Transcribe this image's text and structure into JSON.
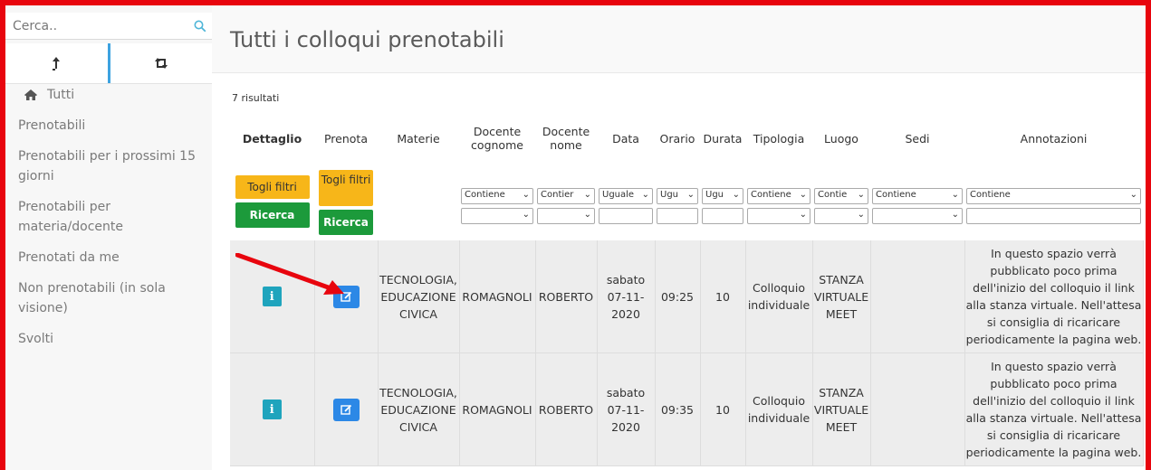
{
  "sidebar": {
    "search_placeholder": "Cerca..",
    "nav": [
      {
        "label": "Tutti",
        "icon": "home-icon"
      },
      {
        "label": "Prenotabili"
      },
      {
        "label": "Prenotabili per i prossimi 15 giorni"
      },
      {
        "label": "Prenotabili per materia/docente"
      },
      {
        "label": "Prenotati da me"
      },
      {
        "label": "Non prenotabili (in sola visione)"
      },
      {
        "label": "Svolti"
      }
    ],
    "icons": [
      "upload-arrow-icon",
      "retweet-icon"
    ]
  },
  "page": {
    "title": "Tutti i colloqui prenotabili",
    "results": "7 risultati"
  },
  "table": {
    "headers": [
      "Dettaglio",
      "Prenota",
      "Materie",
      "Docente cognome",
      "Docente nome",
      "Data",
      "Orario",
      "Durata",
      "Tipologia",
      "Luogo",
      "Sedi",
      "Annotazioni"
    ],
    "filters": {
      "togli_filtri": "Togli filtri",
      "ricerca": "Ricerca",
      "selects": {
        "docente_cognome": "Contiene",
        "docente_nome": "Contier",
        "data": "Uguale",
        "orario": "Ugu",
        "durata": "Ugu",
        "tipologia": "Contiene",
        "luogo": "Contie",
        "sedi": "Contiene",
        "annotazioni": "Contiene"
      }
    },
    "rows": [
      {
        "materie": "TECNOLOGIA, EDUCAZIONE CIVICA",
        "cognome": "ROMAGNOLI",
        "nome": "ROBERTO",
        "data": "sabato 07-11-2020",
        "orario": "09:25",
        "durata": "10",
        "tipologia": "Colloquio individuale",
        "luogo": "STANZA VIRTUALE MEET",
        "sedi": "",
        "annotazioni": "In questo spazio verrà pubblicato poco prima dell'inizio del colloquio il link alla stanza virtuale. Nell'attesa si consiglia di ricaricare periodicamente la pagina web."
      },
      {
        "materie": "TECNOLOGIA, EDUCAZIONE CIVICA",
        "cognome": "ROMAGNOLI",
        "nome": "ROBERTO",
        "data": "sabato 07-11-2020",
        "orario": "09:35",
        "durata": "10",
        "tipologia": "Colloquio individuale",
        "luogo": "STANZA VIRTUALE MEET",
        "sedi": "",
        "annotazioni": "In questo spazio verrà pubblicato poco prima dell'inizio del colloquio il link alla stanza virtuale. Nell'attesa si consiglia di ricaricare periodicamente la pagina web."
      }
    ]
  },
  "colors": {
    "frame": "#e8050e",
    "info_button": "#1fa4bd",
    "edit_button": "#2c88e6",
    "yellow_button": "#f7b619",
    "green_button": "#1c9a3b"
  }
}
